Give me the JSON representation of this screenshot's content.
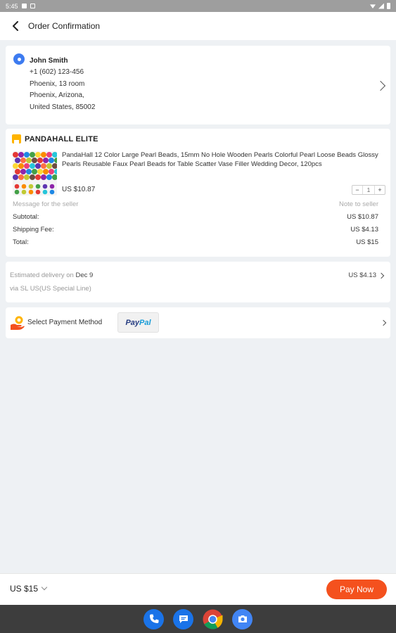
{
  "status_bar": {
    "time": "5:45"
  },
  "app_bar": {
    "title": "Order Confirmation"
  },
  "address": {
    "name": "John Smith",
    "phone": "+1 (602) 123-456",
    "line1": "Phoenix, 13 room",
    "line2": "Phoenix,  Arizona,",
    "line3": "United States, 85002"
  },
  "store": {
    "name": "PANDAHALL ELITE",
    "product_title": "PandaHall 12 Color Large Pearl Beads, 15mm No Hole Wooden Pearls Colorful Pearl Loose Beads Glossy Pearls Reusable Faux Pearl Beads for Table Scatter Vase Filler Wedding Decor, 120pcs",
    "price": "US $10.87",
    "quantity": "1",
    "minus": "−",
    "plus": "+",
    "message_placeholder": "Message for the seller",
    "note_label": "Note to seller",
    "subtotal_label": "Subtotal:",
    "subtotal_value": "US $10.87",
    "shipping_label": "Shipping Fee:",
    "shipping_value": "US $4.13",
    "total_label": "Total:",
    "total_value": "US $15"
  },
  "delivery": {
    "estimated_label": "Estimated delivery on",
    "date": "Dec 9",
    "via": "via SL US(US Special Line)",
    "price": "US $4.13"
  },
  "payment": {
    "label": "Select Payment Method",
    "paypal_part1": "Pay",
    "paypal_part2": "Pal"
  },
  "bottom": {
    "total": "US $15",
    "pay_now": "Pay Now"
  },
  "colors": {
    "accent": "#f4511e",
    "pin_blue": "#3d7bf0",
    "store_icon": "#ffb400",
    "paypal_dark": "#253b80",
    "paypal_light": "#179bd7"
  },
  "icons": [
    "back-arrow-icon",
    "location-pin-icon",
    "chevron-right-icon",
    "store-icon",
    "payment-hand-icon",
    "chevron-down-icon",
    "phone-icon",
    "messages-icon",
    "chrome-icon",
    "camera-icon"
  ]
}
